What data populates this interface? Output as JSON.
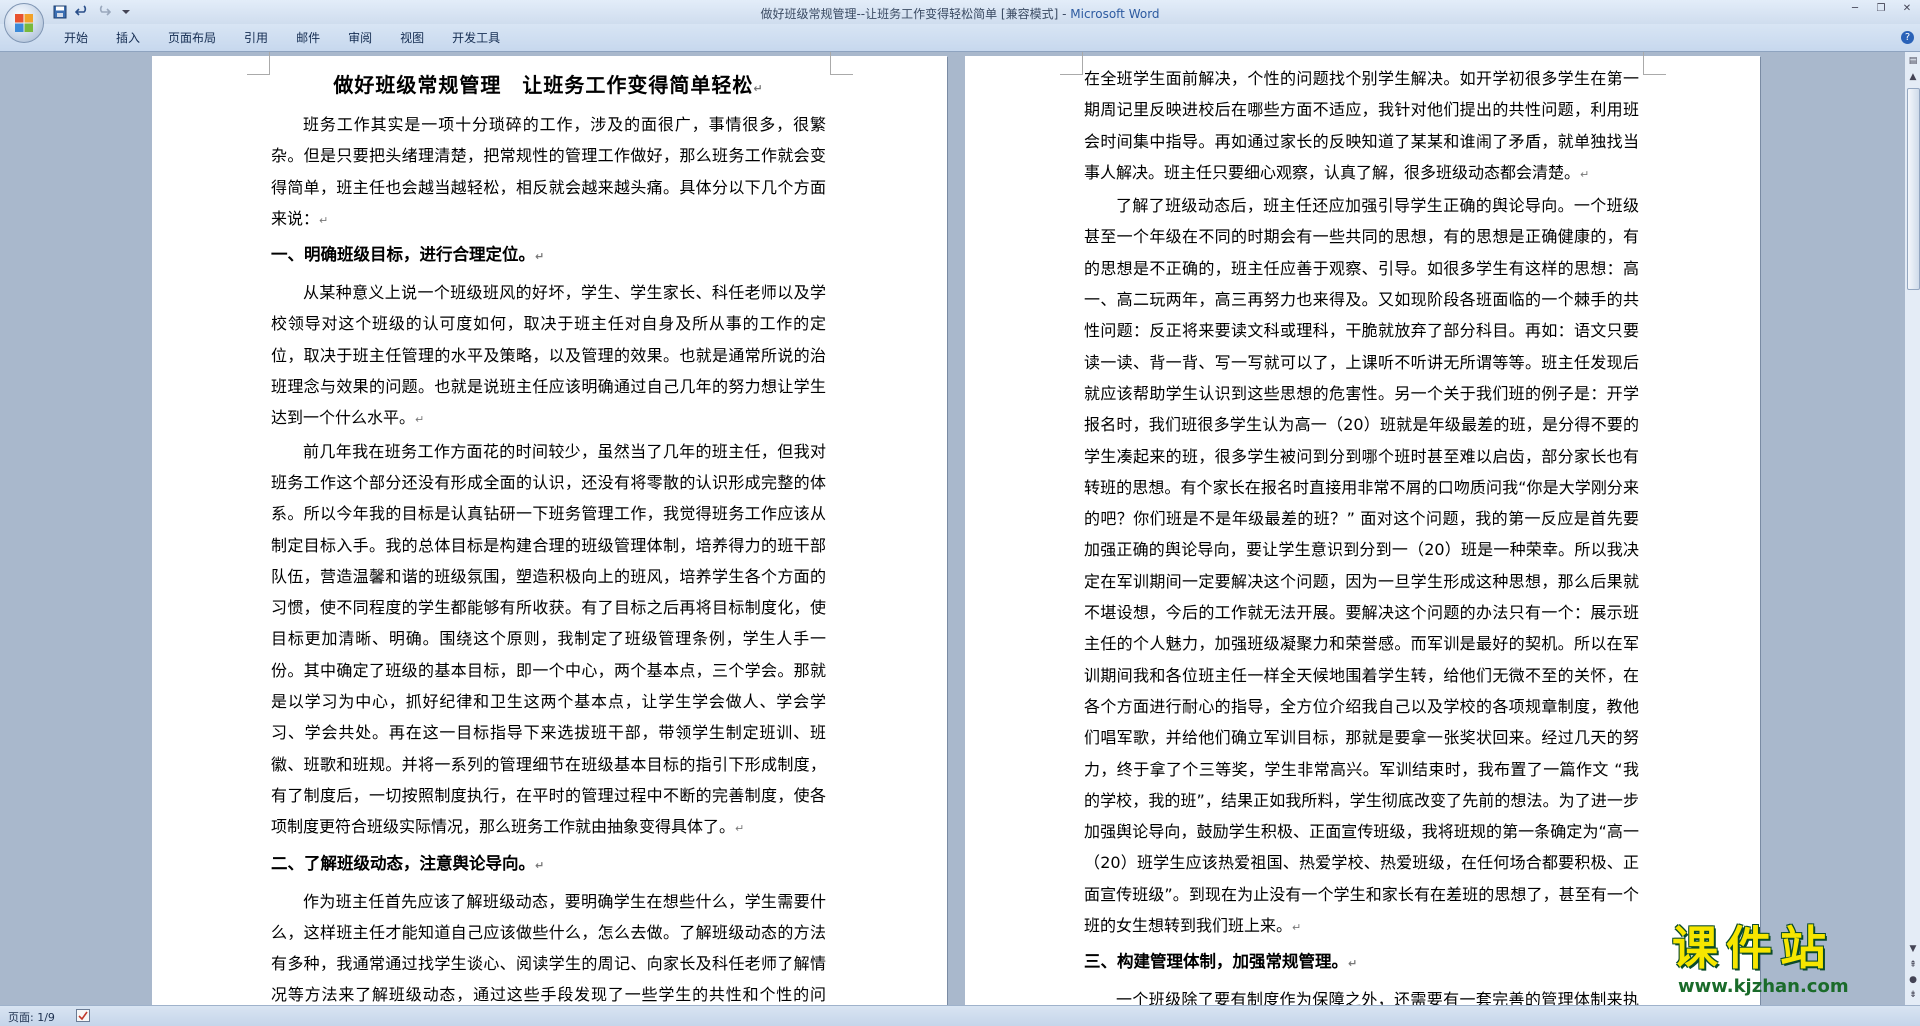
{
  "window": {
    "title": "做好班级常规管理--让班务工作变得轻松简单 [兼容模式] - ",
    "app_name": "Microsoft Word"
  },
  "ribbon": {
    "tabs": [
      "开始",
      "插入",
      "页面布局",
      "引用",
      "邮件",
      "审阅",
      "视图",
      "开发工具"
    ]
  },
  "page1": {
    "title": "做好班级常规管理　让班务工作变得简单轻松",
    "para_intro": "班务工作其实是一项十分琐碎的工作，涉及的面很广，事情很多，很繁杂。但是只要把头绪理清楚，把常规性的管理工作做好，那么班务工作就会变得简单，班主任也会越当越轻松，相反就会越来越头痛。具体分以下几个方面来说：",
    "heading1": "一、明确班级目标，进行合理定位。",
    "para1": "从某种意义上说一个班级班风的好坏，学生、学生家长、科任老师以及学校领导对这个班级的认可度如何，取决于班主任对自身及所从事的工作的定位，取决于班主任管理的水平及策略，以及管理的效果。也就是通常所说的治班理念与效果的问题。也就是说班主任应该明确通过自己几年的努力想让学生达到一个什么水平。",
    "para2": "前几年我在班务工作方面花的时间较少，虽然当了几年的班主任，但我对班务工作这个部分还没有形成全面的认识，还没有将零散的认识形成完整的体系。所以今年我的目标是认真钻研一下班务管理工作，我觉得班务工作应该从制定目标入手。我的总体目标是构建合理的班级管理体制，培养得力的班干部队伍，营造温馨和谐的班级氛围，塑造积极向上的班风，培养学生各个方面的习惯，使不同程度的学生都能够有所收获。有了目标之后再将目标制度化，使目标更加清晰、明确。围绕这个原则，我制定了班级管理条例，学生人手一份。其中确定了班级的基本目标，即一个中心，两个基本点，三个学会。那就是以学习为中心，抓好纪律和卫生这两个基本点，让学生学会做人、学会学习、学会共处。再在这一目标指导下来选拔班干部，带领学生制定班训、班徽、班歌和班规。并将一系列的管理细节在班级基本目标的指引下形成制度，有了制度后，一切按照制度执行，在平时的管理过程中不断的完善制度，使各项制度更符合班级实际情况，那么班务工作就由抽象变得具体了。",
    "heading2": "二、了解班级动态，注意舆论导向。",
    "para3": "作为班主任首先应该了解班级动态，要明确学生在想些什么，学生需要什么，这样班主任才能知道自己应该做些什么，怎么去做。了解班级动态的方法有多种，我通常通过找学生谈心、阅读学生的周记、向家长及科任老师了解情况等方法来了解班级动态，通过这些手段发现了一些学生的共性和个性的问题。共性的问题"
  },
  "page2": {
    "para_cont": "在全班学生面前解决，个性的问题找个别学生解决。如开学初很多学生在第一期周记里反映进校后在哪些方面不适应，我针对他们提出的共性问题，利用班会时间集中指导。再如通过家长的反映知道了某某和谁闹了矛盾，就单独找当事人解决。班主任只要细心观察，认真了解，很多班级动态都会清楚。",
    "para4": "了解了班级动态后，班主任还应加强引导学生正确的舆论导向。一个班级甚至一个年级在不同的时期会有一些共同的思想，有的思想是正确健康的，有的思想是不正确的，班主任应善于观察、引导。如很多学生有这样的思想：高一、高二玩两年，高三再努力也来得及。又如现阶段各班面临的一个棘手的共性问题：反正将来要读文科或理科，干脆就放弃了部分科目。再如：语文只要读一读、背一背、写一写就可以了，上课听不听讲无所谓等等。班主任发现后就应该帮助学生认识到这些思想的危害性。另一个关于我们班的例子是：开学报名时，我们班很多学生认为高一（20）班就是年级最差的班，是分得不要的学生凑起来的班，很多学生被问到分到哪个班时甚至难以启齿，部分家长也有转班的思想。有个家长在报名时直接用非常不屑的口吻质问我“你是大学刚分来的吧？你们班是不是年级最差的班？” 面对这个问题，我的第一反应是首先要加强正确的舆论导向，要让学生意识到分到一（20）班是一种荣幸。所以我决定在军训期间一定要解决这个问题，因为一旦学生形成这种思想，那么后果就不堪设想，今后的工作就无法开展。要解决这个问题的办法只有一个：展示班主任的个人魅力，加强班级凝聚力和荣誉感。而军训是最好的契机。所以在军训期间我和各位班主任一样全天候地围着学生转，给他们无微不至的关怀，在各个方面进行耐心的指导，全方位介绍我自己以及学校的各项规章制度，教他们唱军歌，并给他们确立军训目标，那就是要拿一张奖状回来。经过几天的努力，终于拿了个三等奖，学生非常高兴。军训结束时，我布置了一篇作文 “我的学校，我的班”，结果正如我所料，学生彻底改变了先前的想法。为了进一步加强舆论导向，鼓励学生积极、正面宣传班级，我将班规的第一条确定为“高一（20）班学生应该热爱祖国、热爱学校、热爱班级，在任何场合都要积极、正面宣传班级”。到现在为止没有一个学生和家长有在差班的思想了，甚至有一个班的女生想转到我们班上来。",
    "heading3": "三、构建管理体制，加强常规管理。",
    "para5": "一个班级除了要有制度作为保障之外，还需要有一套完善的管理体制来执行"
  },
  "statusbar": {
    "page_info": "页面: 1/9"
  },
  "watermark": {
    "title": "课件站",
    "url": "www.kjzhan.com"
  },
  "marks": {
    "para": "↵"
  }
}
